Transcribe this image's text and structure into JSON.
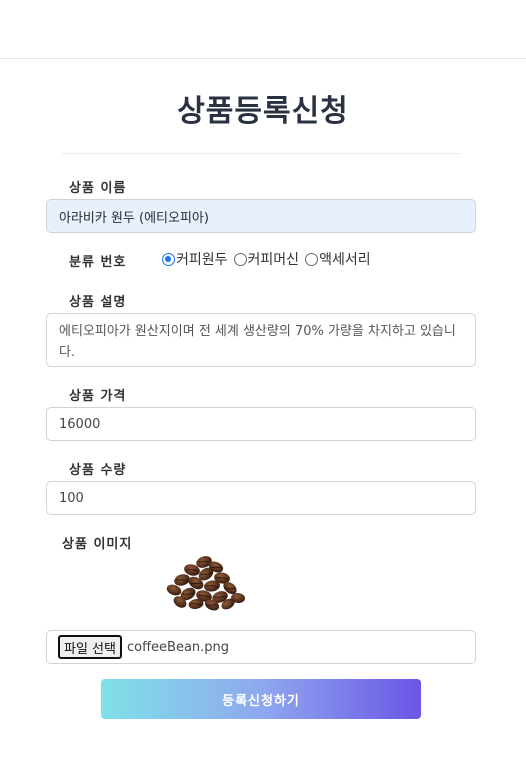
{
  "page": {
    "title": "상품등록신청"
  },
  "form": {
    "name": {
      "label": "상품 이름",
      "value": "아라비카 원두 (에티오피아)"
    },
    "category": {
      "label": "분류 번호",
      "options": [
        "커피원두",
        "커피머신",
        "액세서리"
      ],
      "selected": "커피원두"
    },
    "description": {
      "label": "상품 설명",
      "value": "에티오피아가 원산지이며 전 세계 생산량의 70% 가량을 차지하고 있습니다."
    },
    "price": {
      "label": "상품 가격",
      "value": "16000"
    },
    "quantity": {
      "label": "상품 수량",
      "value": "100"
    },
    "image": {
      "label": "상품 이미지",
      "preview_icon": "coffee-beans-image",
      "file_button_label": "파일 선택",
      "file_name": "coffeeBean.png"
    },
    "submit_label": "등록신청하기"
  },
  "colors": {
    "title": "#2a3140",
    "radio_checked": "#1a73e8",
    "autofill_bg": "#e8f0fe",
    "button_gradient_start": "#7fe1e8",
    "button_gradient_end": "#6b56e6"
  }
}
